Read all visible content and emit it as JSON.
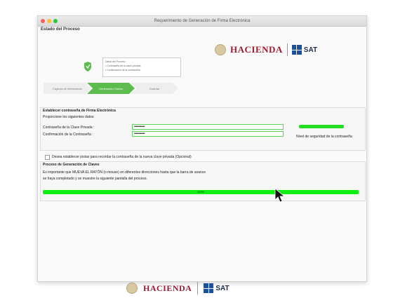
{
  "window": {
    "title": "Requerimiento de Generación de Firma Electrónica"
  },
  "section": {
    "estado_title": "Estado del Proceso"
  },
  "brand": {
    "hacienda": "HACIENDA",
    "sat": "SAT"
  },
  "step_info": {
    "lines": [
      "Datos del Proceso",
      "• Contraseña de la clave privada",
      "• Confirmación de la contraseña"
    ]
  },
  "steps": [
    {
      "label": "Captura de Información"
    },
    {
      "label": "Generación Claves"
    },
    {
      "label": "Guardar"
    }
  ],
  "password_panel": {
    "title": "Establecer contraseña de Firma Electrónica",
    "subtitle": "Proporcione los siguientes datos:",
    "field1_label": "Contraseña de la Clave Privada :",
    "field1_value": "••••••••••••",
    "field2_label": "Confirmación de la Contraseña :",
    "field2_value": "••••••••••••",
    "strength_label": "Nivel de seguridad de la contraseña"
  },
  "checkbox_label": "Desea establecer pistas para recordar la contraseña de la nueva clave privada (Opcional)",
  "progress_panel": {
    "title": "Proceso de Generación de Claves",
    "message_line1": "Es importante que MUEVA EL RATÓN (o mouse) en diferentes direcciones hasta que la barra de avance",
    "message_line2": "se haya completado y se muestre la siguiente pantalla del proceso.",
    "progress_text": "100%",
    "progress_value": 1.0
  }
}
